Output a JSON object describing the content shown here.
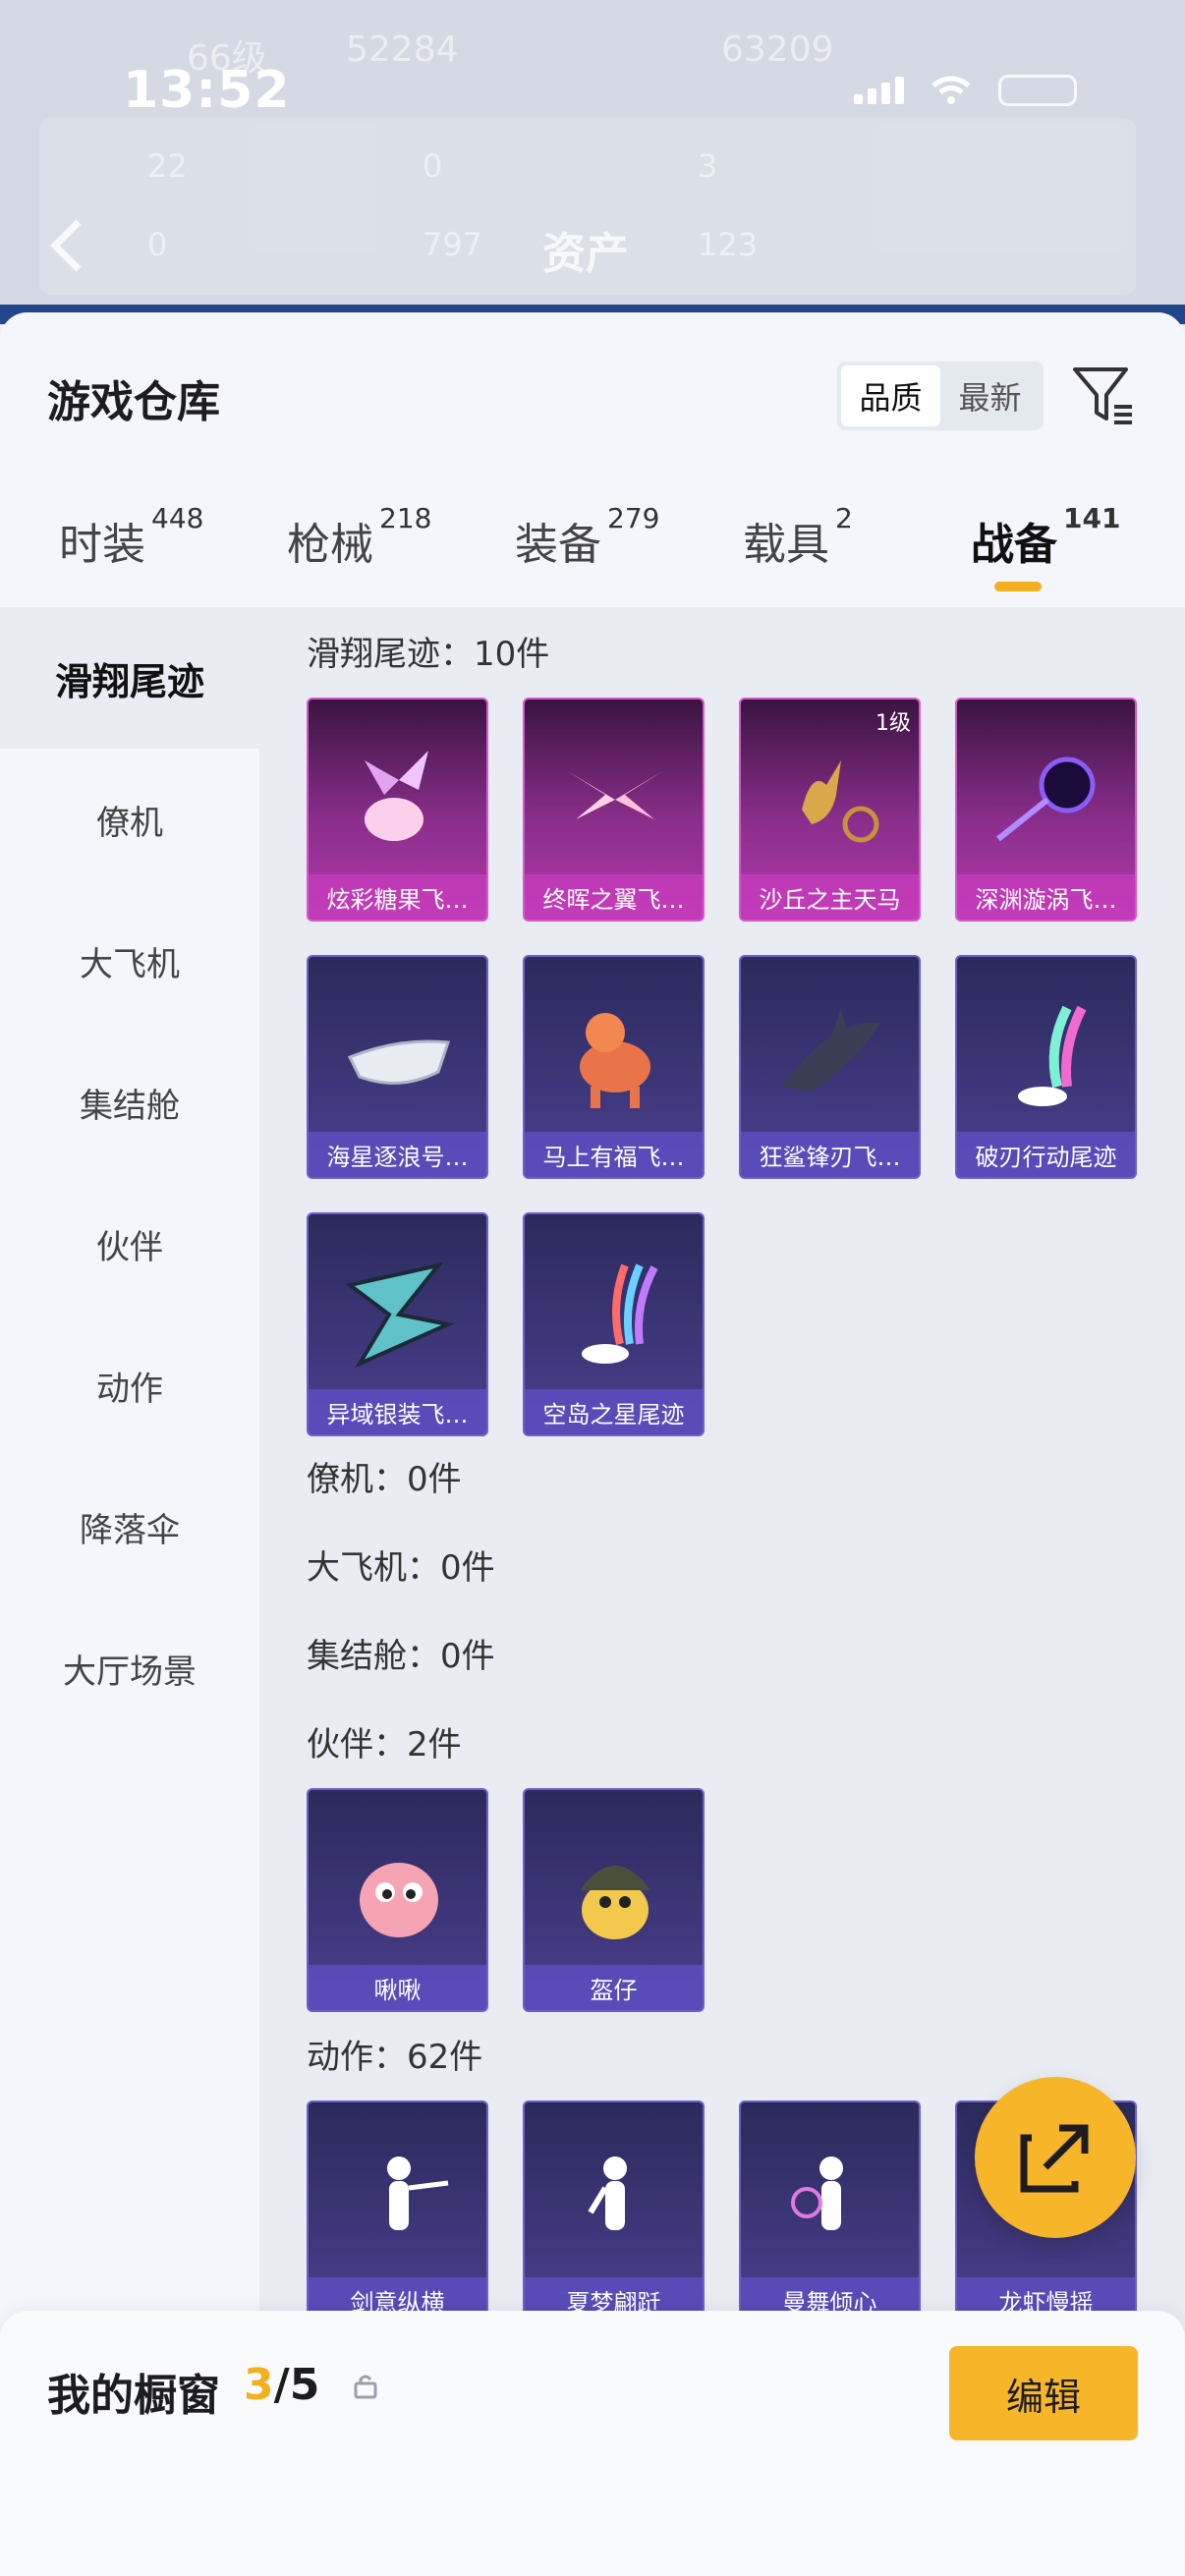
{
  "status": {
    "time": "13:52"
  },
  "behind": {
    "level": "66级",
    "score": "52284",
    "score2": "63209",
    "asset_title": "资产",
    "stats": [
      "22",
      "0",
      "3",
      "0",
      "797",
      "123"
    ]
  },
  "header": {
    "title": "游戏仓库",
    "sort": [
      "品质",
      "最新"
    ],
    "filter_icon": "filter-icon"
  },
  "tabs": [
    {
      "label": "时装",
      "count": "448"
    },
    {
      "label": "枪械",
      "count": "218"
    },
    {
      "label": "装备",
      "count": "279"
    },
    {
      "label": "载具",
      "count": "2"
    },
    {
      "label": "战备",
      "count": "141",
      "active": true
    }
  ],
  "sidebar": {
    "items": [
      "滑翔尾迹",
      "僚机",
      "大飞机",
      "集结舱",
      "伙伴",
      "动作",
      "降落伞",
      "大厅场景"
    ]
  },
  "sections": {
    "glide": {
      "title": "滑翔尾迹：10件",
      "items": [
        {
          "name": "炫彩糖果飞…",
          "level": ""
        },
        {
          "name": "终晖之翼飞…",
          "level": ""
        },
        {
          "name": "沙丘之主天马",
          "level": "1级"
        },
        {
          "name": "深渊漩涡飞…",
          "level": ""
        },
        {
          "name": "海星逐浪号…",
          "level": ""
        },
        {
          "name": "马上有福飞…",
          "level": ""
        },
        {
          "name": "狂鲨锋刃飞…",
          "level": ""
        },
        {
          "name": "破刃行动尾迹",
          "level": ""
        },
        {
          "name": "异域银装飞…",
          "level": ""
        },
        {
          "name": "空岛之星尾迹",
          "level": ""
        }
      ]
    },
    "wingman": {
      "title": "僚机：0件"
    },
    "plane": {
      "title": "大飞机：0件"
    },
    "pod": {
      "title": "集结舱：0件"
    },
    "partner": {
      "title": "伙伴：2件",
      "items": [
        {
          "name": "啾啾"
        },
        {
          "name": "盔仔"
        }
      ]
    },
    "emote": {
      "title": "动作：62件",
      "items": [
        {
          "name": "剑意纵横"
        },
        {
          "name": "夏梦翩跹"
        },
        {
          "name": "曼舞倾心"
        },
        {
          "name": "龙虾慢摇"
        }
      ]
    }
  },
  "showcase": {
    "label": "我的橱窗",
    "current": "3",
    "total": "/5",
    "edit": "编辑"
  },
  "colors": {
    "accent": "#f7b52a",
    "card_purple": "#4b3f8e",
    "card_pink": "#b23aa9"
  }
}
